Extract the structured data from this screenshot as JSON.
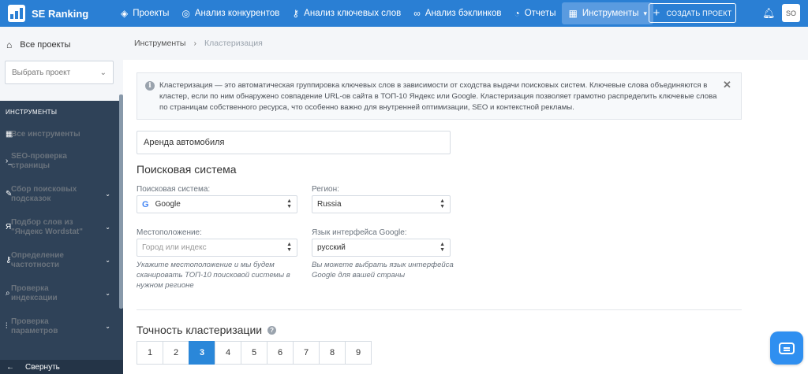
{
  "app": {
    "logo_text": "SE Ranking"
  },
  "nav": [
    {
      "label": "Проекты",
      "icon": "layers-icon",
      "glyph": "◈"
    },
    {
      "label": "Анализ конкурентов",
      "icon": "target-icon",
      "glyph": "◎"
    },
    {
      "label": "Анализ ключевых слов",
      "icon": "key-icon",
      "glyph": "⚷"
    },
    {
      "label": "Анализ бэклинков",
      "icon": "link-icon",
      "glyph": "∞"
    },
    {
      "label": "Отчеты",
      "icon": "pie-chart-icon",
      "glyph": "◔"
    },
    {
      "label": "Инструменты",
      "icon": "grid-icon",
      "glyph": "▦"
    }
  ],
  "header": {
    "create_project": "СОЗДАТЬ ПРОЕКТ",
    "avatar": "SO"
  },
  "sidebar": {
    "all_projects": "Все проекты",
    "select_project_placeholder": "Выбрать проект",
    "section_title": "ИНСТРУМЕНТЫ",
    "items": [
      {
        "label": "Все инструменты",
        "icon": "grid-icon",
        "glyph": "▦",
        "has_chevron": false
      },
      {
        "label": "SEO-проверка страницы",
        "icon": "terminal-icon",
        "glyph": "›_",
        "has_chevron": false
      },
      {
        "label": "Сбор поисковых подсказок",
        "icon": "pencil-icon",
        "glyph": "✎",
        "has_chevron": true
      },
      {
        "label": "Подбор слов из \"Яндекс Wordstat\"",
        "icon": "yandex-icon",
        "glyph": "Я",
        "has_chevron": true
      },
      {
        "label": "Определение частотности",
        "icon": "key-icon",
        "glyph": "⚷",
        "has_chevron": true
      },
      {
        "label": "Проверка индексации",
        "icon": "search-icon",
        "glyph": "⌕",
        "has_chevron": true
      },
      {
        "label": "Проверка параметров",
        "icon": "sliders-icon",
        "glyph": "⫶",
        "has_chevron": true
      }
    ],
    "collapse": "Свернуть"
  },
  "breadcrumb": {
    "parent": "Инструменты",
    "current": "Кластеризация"
  },
  "info": {
    "text": "Кластеризация — это автоматическая группировка ключевых слов в зависимости от сходства выдачи поисковых систем. Ключевые слова объединяются в кластер, если по ним обнаружено совпадение URL-ов сайта в ТОП-10 Яндекс или Google. Кластеризация позволяет грамотно распределить ключевые слова по страницам собственного ресурса, что особенно важно для внутренней оптимизации, SEO и контекстной рекламы."
  },
  "form": {
    "keyword_value": "Аренда автомобиля",
    "search_heading": "Поисковая система",
    "engine_label": "Поисковая система:",
    "engine_value": "Google",
    "region_label": "Регион:",
    "region_value": "Russia",
    "location_label": "Местоположение:",
    "location_placeholder": "Город или индекс",
    "location_hint": "Укажите местоположение и мы будем сканировать ТОП-10 поисковой системы в нужном регионе",
    "language_label": "Язык интерфейса Google:",
    "language_value": "русский",
    "language_hint": "Вы можете выбрать язык интерфейса Google для вашей страны"
  },
  "accuracy": {
    "heading": "Точность кластеризации",
    "options": [
      "1",
      "2",
      "3",
      "4",
      "5",
      "6",
      "7",
      "8",
      "9"
    ],
    "selected": "3"
  }
}
